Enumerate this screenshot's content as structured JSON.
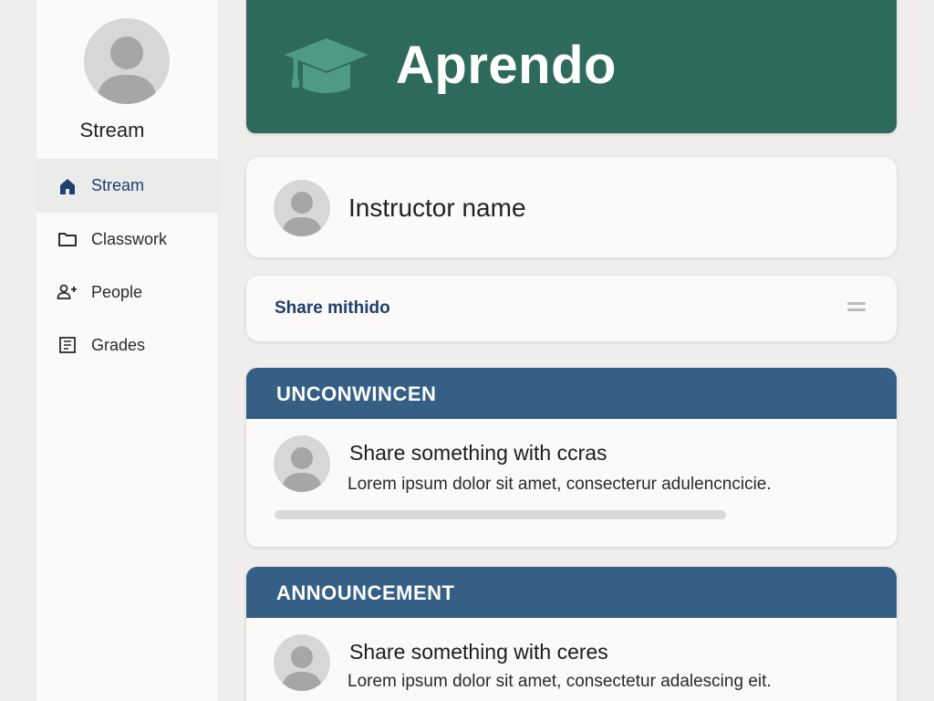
{
  "sidebar": {
    "title": "Stream",
    "items": [
      {
        "label": "Stream",
        "icon": "home-icon",
        "active": true
      },
      {
        "label": "Classwork",
        "icon": "folder-icon",
        "active": false
      },
      {
        "label": "People",
        "icon": "people-add-icon",
        "active": false
      },
      {
        "label": "Grades",
        "icon": "gradebook-icon",
        "active": false
      }
    ]
  },
  "banner": {
    "title": "Aprendo",
    "icon": "graduation-cap-icon"
  },
  "instructor": {
    "name": "Instructor name"
  },
  "share": {
    "label": "Share mithido",
    "icon": "menu-icon"
  },
  "posts": [
    {
      "header": "UNCONWINCEN",
      "heading": "Share something with ccras",
      "body": "Lorem ipsum dolor sit amet, consecterur adulencncicie."
    },
    {
      "header": "ANNOUNCEMENT",
      "heading": "Share something with ceres",
      "body": "Lorem ipsum dolor sit amet, consectetur adalescing eit."
    }
  ],
  "colors": {
    "banner": "#2e6a5b",
    "post_header": "#365f86",
    "accent_text": "#1f3f6e",
    "avatar": "#d7d7d7"
  }
}
